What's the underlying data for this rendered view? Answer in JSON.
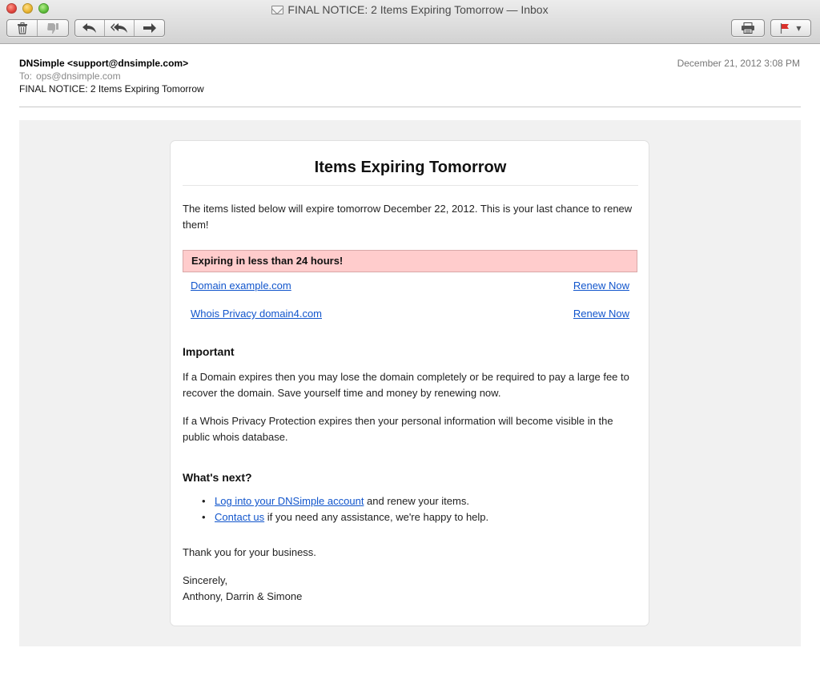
{
  "window": {
    "title": "FINAL NOTICE: 2 Items Expiring Tomorrow — Inbox",
    "toolbar": {
      "delete_icon": "trash-icon",
      "junk_icon": "thumbs-down-icon",
      "reply_icon": "reply-arrow-icon",
      "reply_all_icon": "reply-all-arrow-icon",
      "forward_icon": "forward-arrow-icon",
      "print_icon": "printer-icon",
      "flag_icon": "red-flag-icon"
    }
  },
  "header": {
    "from": "DNSimple <support@dnsimple.com>",
    "to_label": "To:",
    "to": "ops@dnsimple.com",
    "subject": "FINAL NOTICE: 2 Items Expiring Tomorrow",
    "date": "December 21, 2012 3:08 PM"
  },
  "email": {
    "title": "Items Expiring Tomorrow",
    "intro": "The items listed below will expire tomorrow December 22, 2012. This is your last chance to renew them!",
    "alert": "Expiring in less than 24 hours!",
    "items": [
      {
        "name": "Domain example.com",
        "action": "Renew Now"
      },
      {
        "name": "Whois Privacy domain4.com",
        "action": "Renew Now"
      }
    ],
    "important_heading": "Important",
    "important_p1": "If a Domain expires then you may lose the domain completely or be required to pay a large fee to recover the domain. Save yourself time and money by renewing now.",
    "important_p2": "If a Whois Privacy Protection expires then your personal information will become visible in the public whois database.",
    "next_heading": "What's next?",
    "next_items": [
      {
        "link": "Log into your DNSimple account",
        "text": " and renew your items."
      },
      {
        "link": "Contact us",
        "text": " if you need any assistance, we're happy to help."
      }
    ],
    "thanks": "Thank you for your business.",
    "sincerely": "Sincerely,",
    "signers": "Anthony, Darrin & Simone"
  },
  "colors": {
    "link": "#1155cc",
    "alert_bg": "#ffcccc",
    "body_bg": "#f1f1f1"
  }
}
